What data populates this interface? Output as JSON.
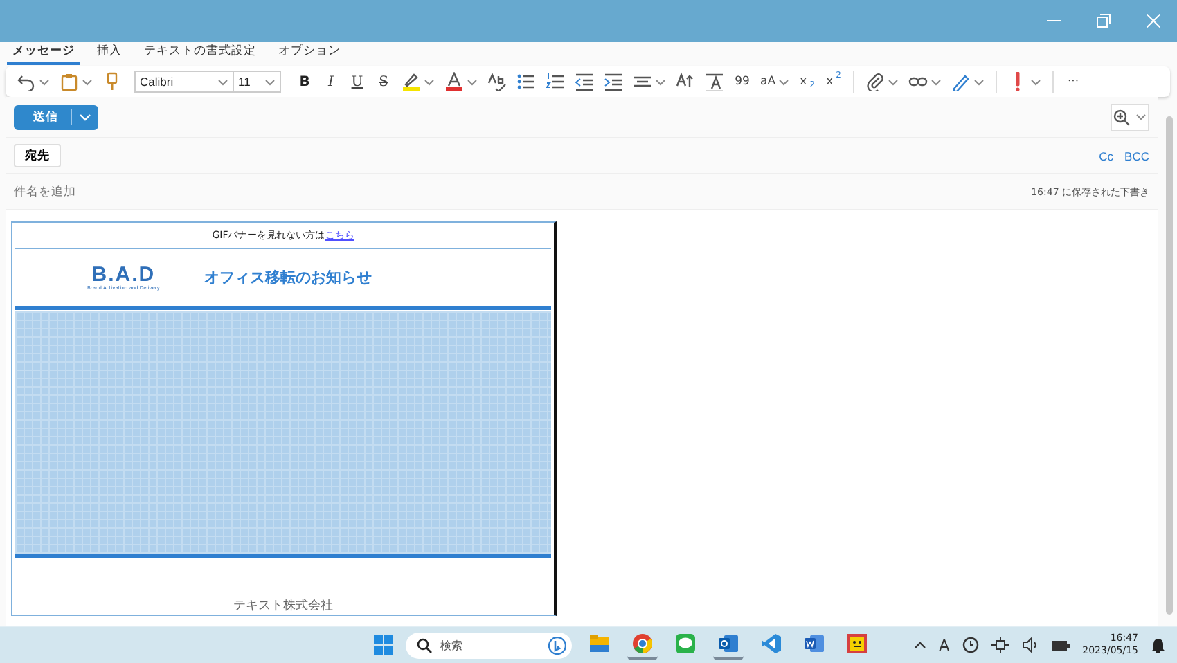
{
  "tabs": [
    {
      "label": "メッセージ",
      "selected": true
    },
    {
      "label": "挿入",
      "selected": false
    },
    {
      "label": "テキストの書式設定",
      "selected": false
    },
    {
      "label": "オプション",
      "selected": false
    }
  ],
  "toolbar": {
    "font": "Calibri",
    "size": "11",
    "bold": "B",
    "italic": "I",
    "underline": "U",
    "strike": "S",
    "quote": "99",
    "case": "aA",
    "subscript": "x$_{2}$",
    "superscript": "x$^{2}$",
    "more": "···"
  },
  "send_button": "送信",
  "to_button": "宛先",
  "cc_link": "Cc",
  "bcc_link": "BCC",
  "subject": {
    "placeholder": "件名を追加"
  },
  "draft_status": "16:47 に保存された下書き",
  "email": {
    "banner_text": "GIFバナーを見れない方は",
    "banner_link": "こちら",
    "logo": "B.A.D",
    "logo_tagline": "Brand Activation and Delivery",
    "heading": "オフィス移転のお知らせ",
    "company": "テキスト株式会社"
  },
  "taskbar": {
    "search": {
      "placeholder": "検索"
    },
    "apps": [
      {
        "active": false
      },
      {
        "active": true
      },
      {
        "active": false
      },
      {
        "active": true
      },
      {
        "active": false
      },
      {
        "active": false
      },
      {
        "active": false
      }
    ],
    "ime": "A",
    "time": "16:47",
    "date": "2023/05/15"
  }
}
